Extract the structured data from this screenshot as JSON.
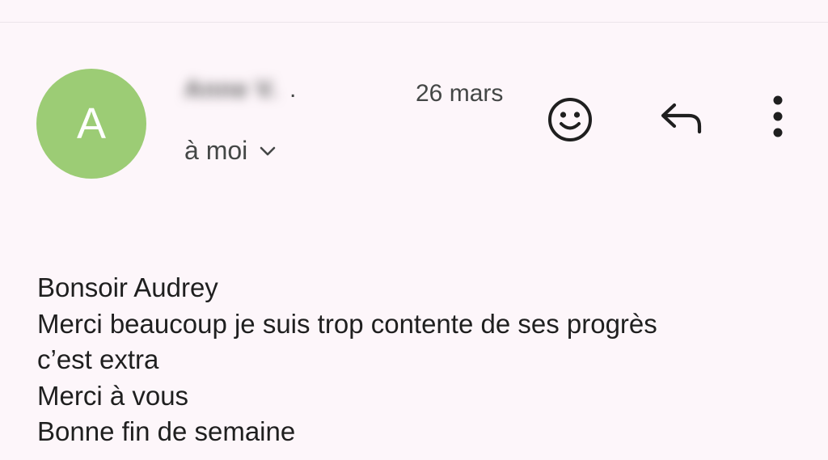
{
  "header": {
    "avatar_initial": "A",
    "sender_name": "Anne V.",
    "sender_separator": ".",
    "date": "26 mars",
    "recipient": "à moi"
  },
  "actions": {
    "emoji_icon": "smiley-icon",
    "reply_icon": "reply-icon",
    "more_icon": "more-vert-icon"
  },
  "message": {
    "lines": [
      "Bonsoir Audrey",
      "Merci beaucoup je suis trop contente de ses progrès",
      "c’est extra",
      "Merci à vous",
      "Bonne fin de semaine"
    ]
  },
  "colors": {
    "background": "#fdf6fa",
    "avatar": "#9ccc75",
    "icon": "#1f1f1f",
    "secondary_text": "#444746"
  }
}
